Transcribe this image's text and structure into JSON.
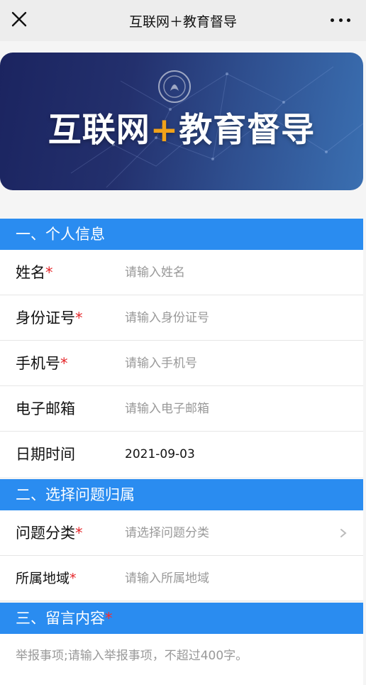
{
  "header": {
    "title": "互联网＋教育督导",
    "close_icon": "close-icon",
    "more_icon": "more-dots-icon"
  },
  "banner": {
    "title_part1": "互联网",
    "title_plus": "+",
    "title_part2": "教育督导",
    "emblem_icon": "school-emblem-icon",
    "colors": {
      "from": "#1b2460",
      "to": "#3a6fb1",
      "plus": "#f1a21a"
    }
  },
  "sections": {
    "personal": {
      "label": "一、个人信息"
    },
    "category": {
      "label": "二、选择问题归属"
    },
    "message": {
      "label": "三、留言内容",
      "required_mark": "*"
    }
  },
  "fields": {
    "name": {
      "label": "姓名",
      "required_mark": "*",
      "placeholder": "请输入姓名"
    },
    "id_number": {
      "label": "身份证号",
      "required_mark": "*",
      "placeholder": "请输入身份证号"
    },
    "phone": {
      "label": "手机号",
      "required_mark": "*",
      "placeholder": "请输入手机号"
    },
    "email": {
      "label": "电子邮箱",
      "placeholder": "请输入电子邮箱"
    },
    "datetime": {
      "label": "日期时间",
      "value": "2021-09-03"
    },
    "problem_category": {
      "label": "问题分类",
      "required_mark": "*",
      "placeholder": "请选择问题分类"
    },
    "region": {
      "label": "所属地域",
      "required_mark": "*",
      "placeholder": "请输入所属地域"
    },
    "report": {
      "placeholder": "举报事项;请输入举报事项，不超过400字。"
    }
  },
  "colors": {
    "section_bg": "#2a8cf0",
    "required": "#e5262a",
    "placeholder": "#999999"
  }
}
